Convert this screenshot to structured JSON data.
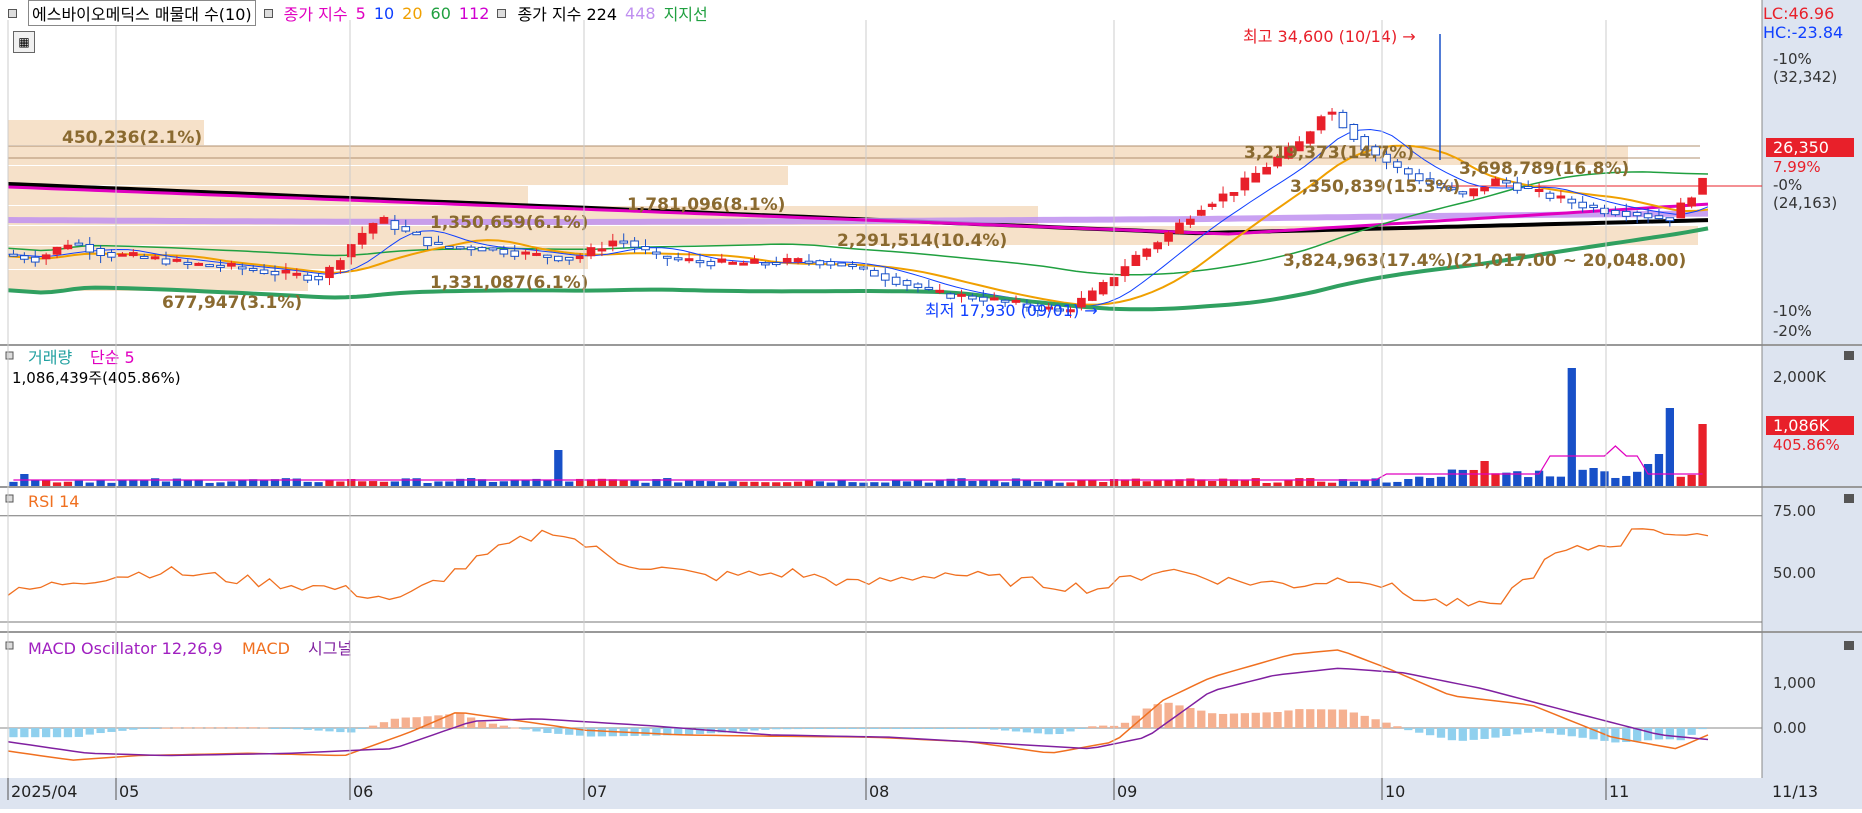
{
  "legend": {
    "title": "에스바이오메딕스 매물대 수(10)",
    "ma_label": "종가 지수",
    "ma_periods": [
      {
        "label": "5",
        "color": "#e000c0"
      },
      {
        "label": "10",
        "color": "#1040ff"
      },
      {
        "label": "20",
        "color": "#f0a000"
      },
      {
        "label": "60",
        "color": "#20a040"
      },
      {
        "label": "112",
        "color": "#d000d0"
      }
    ],
    "ma2_label": "종가 지수 224",
    "ma2_extra": "448",
    "support_label": "지지선",
    "lc": "LC:46.96",
    "hc": "HC:-23.84"
  },
  "price_axis": {
    "top_pct": "10%",
    "top_value": "(32,342)",
    "zero_pct": "0%",
    "zero_value": "(24,163)",
    "neg10": "-10%",
    "neg20": "-20%",
    "current": "26,350",
    "current_pct": "7.99%"
  },
  "annotations": {
    "high": "최고 34,600 (10/14)",
    "low": "최저 17,930 (09/01)",
    "volume_profile": [
      "450,236(2.1%)",
      "1,781,096(8.1%)",
      "1,350,659(6.1%)",
      "2,291,514(10.4%)",
      "1,331,087(6.1%)",
      "677,947(3.1%)",
      "3,219,373(14.7%)",
      "3,698,789(16.8%)",
      "3,350,839(15.3%)",
      "3,824,963(17.4%)(21,017.00 ~ 20,048.00)"
    ]
  },
  "volume_panel": {
    "title": "거래량",
    "ma_label": "단순 5",
    "current_text": "1,086,439주(405.86%)",
    "axis_top": "2,000K",
    "current": "1,086K",
    "current_pct": "405.86%"
  },
  "rsi_panel": {
    "title": "RSI 14",
    "axis_75": "75.00",
    "axis_50": "50.00"
  },
  "macd_panel": {
    "title": "MACD Oscillator 12,26,9",
    "macd_label": "MACD",
    "signal_label": "시그널",
    "axis_1000": "1,000",
    "axis_0": "0.00"
  },
  "x_axis": {
    "labels": [
      "2025/04",
      "05",
      "06",
      "07",
      "08",
      "09",
      "10",
      "11"
    ],
    "end_date": "11/13"
  },
  "colors": {
    "up": "#e8202a",
    "down": "#1850c8",
    "axis_bg": "#dde4f0",
    "profile": "#f5dcc0",
    "rsi": "#f07020",
    "macd": "#f07020",
    "signal": "#8020a0",
    "osc_pos": "#f5b090",
    "osc_neg": "#90d0ee"
  },
  "chart_data": {
    "type": "candlestick",
    "x": "daily, 2025/04 – 11/13",
    "price_high": 34600,
    "price_low": 17930,
    "price_current": 26350,
    "price_range": [
      19000,
      35000
    ],
    "volume_current": 1086439,
    "volume_max_k": 2000,
    "rsi_range": [
      0,
      100
    ],
    "rsi_levels": [
      75,
      50
    ],
    "macd_levels": [
      1000,
      0
    ],
    "volume_profile_pct": [
      2.1,
      8.1,
      6.1,
      10.4,
      6.1,
      3.1,
      14.7,
      16.8,
      15.3,
      17.4
    ]
  }
}
